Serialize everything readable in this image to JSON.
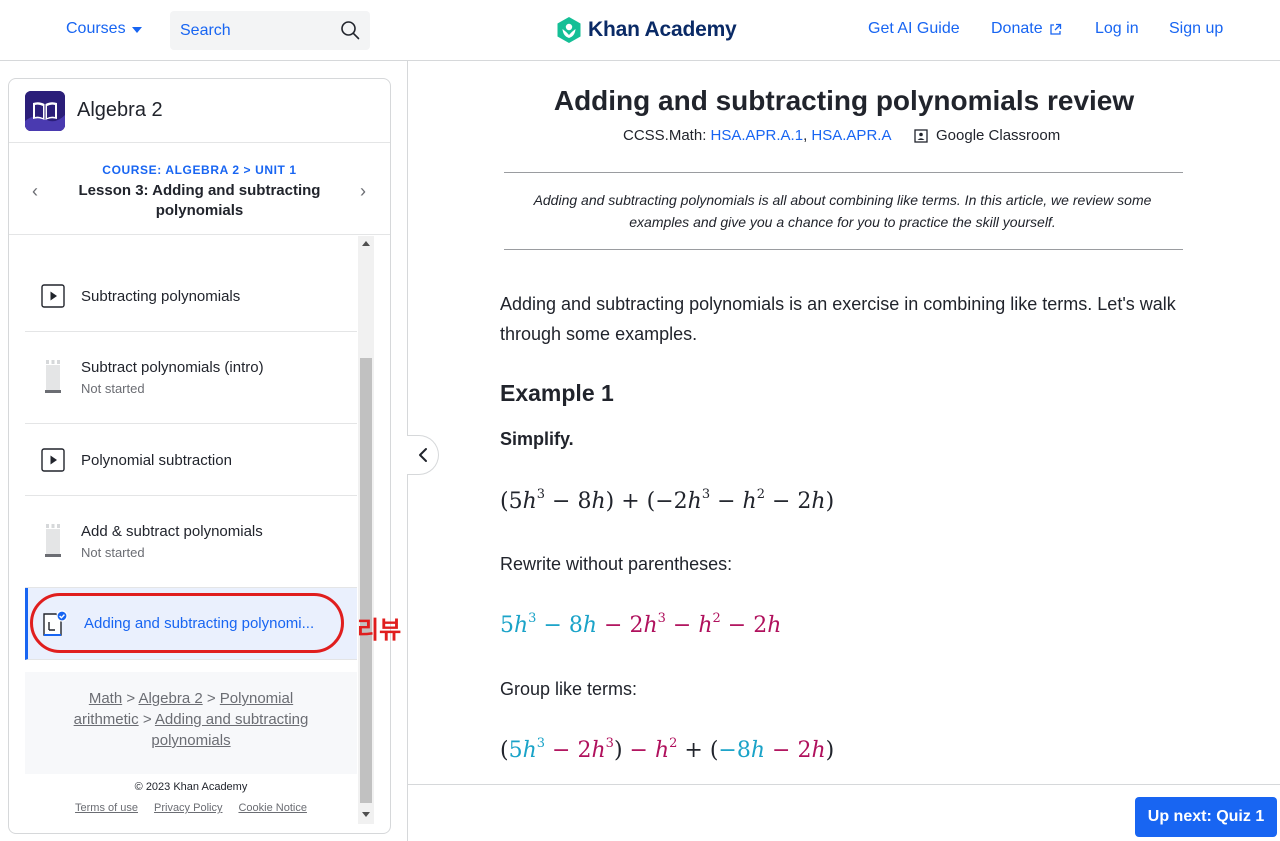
{
  "header": {
    "courses_label": "Courses",
    "search_placeholder": "Search",
    "logo_text": "Khan Academy",
    "links": [
      "Get AI Guide",
      "Donate",
      "Log in",
      "Sign up"
    ],
    "colors": {
      "accent": "#1865f2",
      "logo_green": "#14bf96",
      "logo_navy": "#0a2a66"
    }
  },
  "sidebar": {
    "course_title": "Algebra 2",
    "lesson_kicker": "COURSE: ALGEBRA 2 > UNIT 1",
    "lesson_title": "Lesson 3: Adding and subtracting polynomials",
    "items": [
      {
        "type": "video",
        "icon": "play-icon",
        "label": "Subtracting polynomials",
        "status": ""
      },
      {
        "type": "exercise",
        "icon": "exercise-bar-icon",
        "label": "Subtract polynomials (intro)",
        "status": "Not started"
      },
      {
        "type": "video",
        "icon": "play-icon",
        "label": "Polynomial subtraction",
        "status": ""
      },
      {
        "type": "exercise",
        "icon": "exercise-bar-icon",
        "label": "Add & subtract polynomials",
        "status": "Not started"
      },
      {
        "type": "article",
        "icon": "article-check-icon",
        "label": "Adding and subtracting polynomi...",
        "status": "",
        "active": true
      }
    ],
    "breadcrumbs": {
      "math": "Math",
      "sep": ">",
      "algebra2": "Algebra 2",
      "poly": "Polynomial arithmetic",
      "adding": "Adding and subtracting polynomials"
    },
    "footer": {
      "copyright": "© 2023 Khan Academy",
      "links": [
        "Terms of use",
        "Privacy Policy",
        "Cookie Notice"
      ]
    },
    "annotation": "리뷰"
  },
  "article": {
    "title": "Adding and subtracting polynomials review",
    "standards_prefix": "CCSS.Math: ",
    "standards": [
      "HSA.APR.A.1",
      "HSA.APR.A"
    ],
    "google_classroom": "Google Classroom",
    "summary": "Adding and subtracting polynomials is all about combining like terms. In this article, we review some examples and give you a chance for you to practice the skill yourself.",
    "intro": "Adding and subtracting polynomials is an exercise in combining like terms. Let's walk through some examples.",
    "example_heading": "Example 1",
    "simplify": "Simplify.",
    "step1": "Rewrite without parentheses:",
    "step2": "Group like terms:",
    "math_colors": {
      "teal": "#1aa3c8",
      "magenta": "#b0115d"
    }
  },
  "footer_bar": {
    "up_next": "Up next: Quiz 1"
  }
}
